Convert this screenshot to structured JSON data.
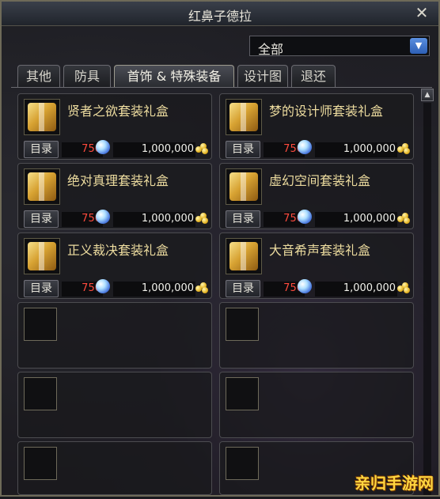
{
  "window": {
    "title": "红鼻子德拉",
    "close_icon": "close-icon"
  },
  "filter": {
    "selected": "全部"
  },
  "tabs": [
    {
      "label": "其他"
    },
    {
      "label": "防具"
    },
    {
      "label": "首饰 & 特殊装备"
    },
    {
      "label": "设计图"
    },
    {
      "label": "退还"
    }
  ],
  "active_tab_index": 2,
  "items": [
    {
      "name": "贤者之欲套装礼盒",
      "catalog_label": "目录",
      "price": "750",
      "gold": "1,000,000"
    },
    {
      "name": "梦的设计师套装礼盒",
      "catalog_label": "目录",
      "price": "750",
      "gold": "1,000,000"
    },
    {
      "name": "绝对真理套装礼盒",
      "catalog_label": "目录",
      "price": "750",
      "gold": "1,000,000"
    },
    {
      "name": "虚幻空间套装礼盒",
      "catalog_label": "目录",
      "price": "750",
      "gold": "1,000,000"
    },
    {
      "name": "正义裁决套装礼盒",
      "catalog_label": "目录",
      "price": "750",
      "gold": "1,000,000"
    },
    {
      "name": "大音希声套装礼盒",
      "catalog_label": "目录",
      "price": "750",
      "gold": "1,000,000"
    }
  ],
  "watermark": "亲归手游网",
  "colors": {
    "price": "#ff4b3e",
    "item_name": "#eddc9f",
    "accent": "#3a6fd0"
  }
}
